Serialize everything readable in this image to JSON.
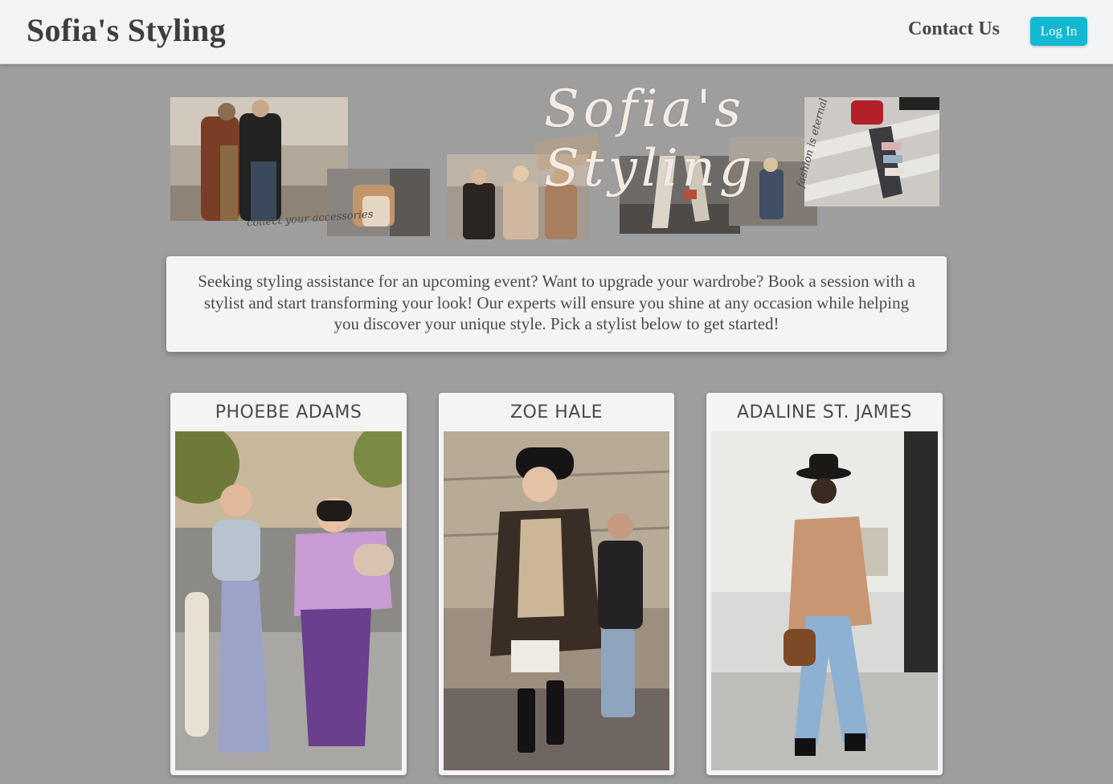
{
  "header": {
    "brand": "Sofia's Styling",
    "contact_label": "Contact Us",
    "login_label": "Log In",
    "accent_color": "#13b9d2"
  },
  "banner": {
    "script_title": "Sofia's Styling",
    "caption_left": "collect your accessories",
    "caption_right": "fashion is eternal"
  },
  "intro": {
    "text": "Seeking styling assistance for an upcoming event? Want to upgrade your wardrobe? Book a session with a stylist and start transforming your look! Our experts will ensure you shine at any occasion while helping you discover your unique style. Pick a stylist below to get started!"
  },
  "stylists": [
    {
      "name": "PHOEBE ADAMS"
    },
    {
      "name": "ZOE HALE"
    },
    {
      "name": "ADALINE ST. JAMES"
    }
  ]
}
